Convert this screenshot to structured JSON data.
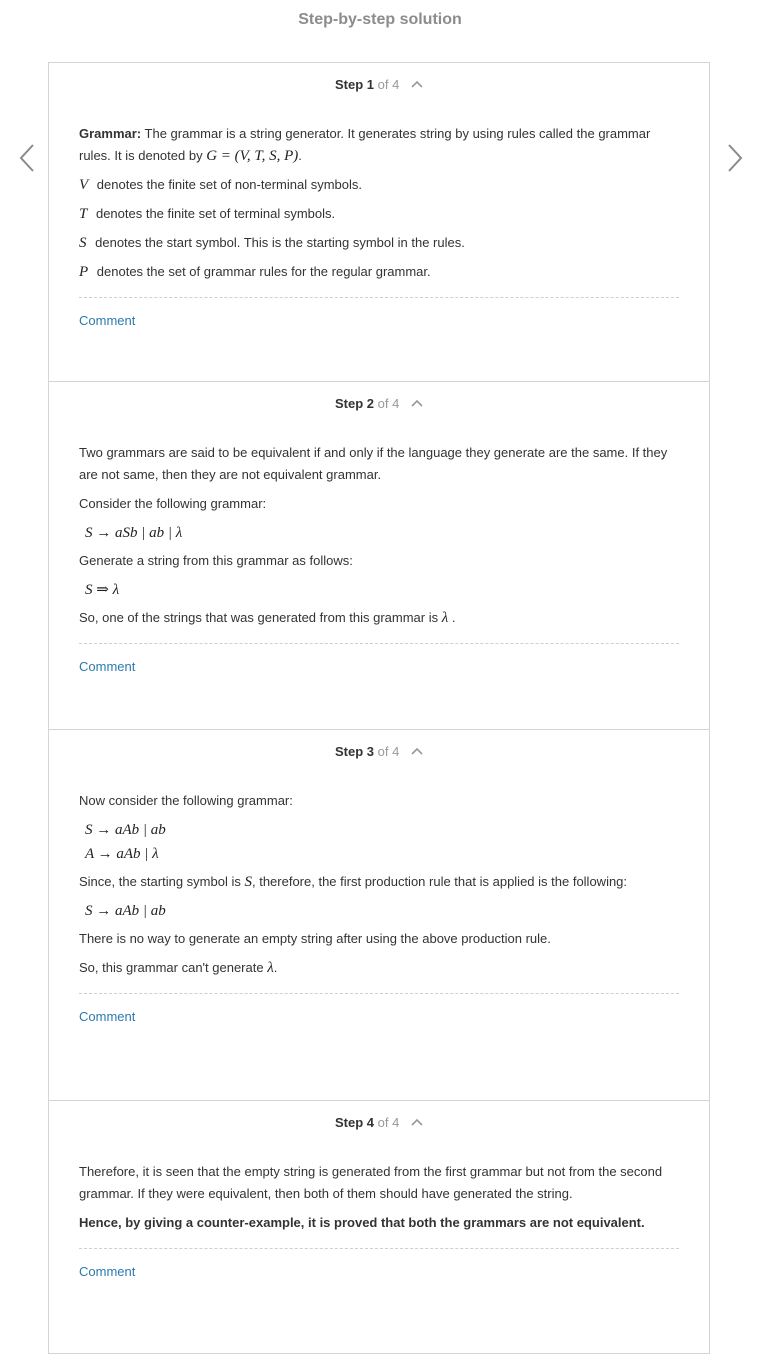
{
  "page": {
    "title": "Step-by-step solution"
  },
  "colors": {
    "link": "#2a7ab0",
    "muted": "#999999",
    "border": "#d4d4d4"
  },
  "icons": {
    "prev": "chevron-left-icon",
    "next": "chevron-right-icon",
    "collapse": "chevron-up-icon"
  },
  "steps": [
    {
      "label": "Step 1",
      "of": "of 4",
      "comment": "Comment",
      "grammar_term": "Grammar:",
      "p1": "The grammar is a string generator. It generates string by using rules called the grammar rules. It is denoted by",
      "p1_math": "G = (V, T, S, P)",
      "p1_end": ".",
      "v_sym": "V",
      "v_text": "denotes the finite set of non-terminal symbols.",
      "t_sym": "T",
      "t_text": "denotes the finite set of terminal symbols.",
      "s_sym": "S",
      "s_text": "denotes the start symbol. This is the starting symbol in the rules.",
      "p_sym": "P",
      "p_text": "denotes the set of grammar rules for the regular grammar."
    },
    {
      "label": "Step 2",
      "of": "of 4",
      "comment": "Comment",
      "p1": "Two grammars are said to be equivalent if and only if the language they generate are the same. If they are not same, then they are not equivalent grammar.",
      "p2": "Consider the following grammar:",
      "rule1": "S → aSb | ab | λ",
      "p3": "Generate a string from this grammar as follows:",
      "derivation": "S ⇒ λ",
      "p4": "So, one of the strings that was generated from this grammar is",
      "p4_math": "λ",
      "p4_end": "."
    },
    {
      "label": "Step 3",
      "of": "of 4",
      "comment": "Comment",
      "p1": "Now consider the following grammar:",
      "rule1": "S → aAb | ab",
      "rule2": "A → aAb | λ",
      "p2_start": "Since, the starting symbol is",
      "p2_math": "S",
      "p2_end": ", therefore, the first production rule that is applied is the following:",
      "rule3": "S → aAb | ab",
      "p3": "There is no way to generate an empty string after using the above production rule.",
      "p4": "So, this grammar can't generate",
      "p4_math": "λ",
      "p4_end": "."
    },
    {
      "label": "Step 4",
      "of": "of 4",
      "comment": "Comment",
      "p1": "Therefore, it is seen that the empty string is generated from the first grammar but not from the second grammar. If they were equivalent, then both of them should have generated the string.",
      "p2": "Hence, by giving a counter-example, it is proved that both the grammars are not equivalent."
    }
  ]
}
